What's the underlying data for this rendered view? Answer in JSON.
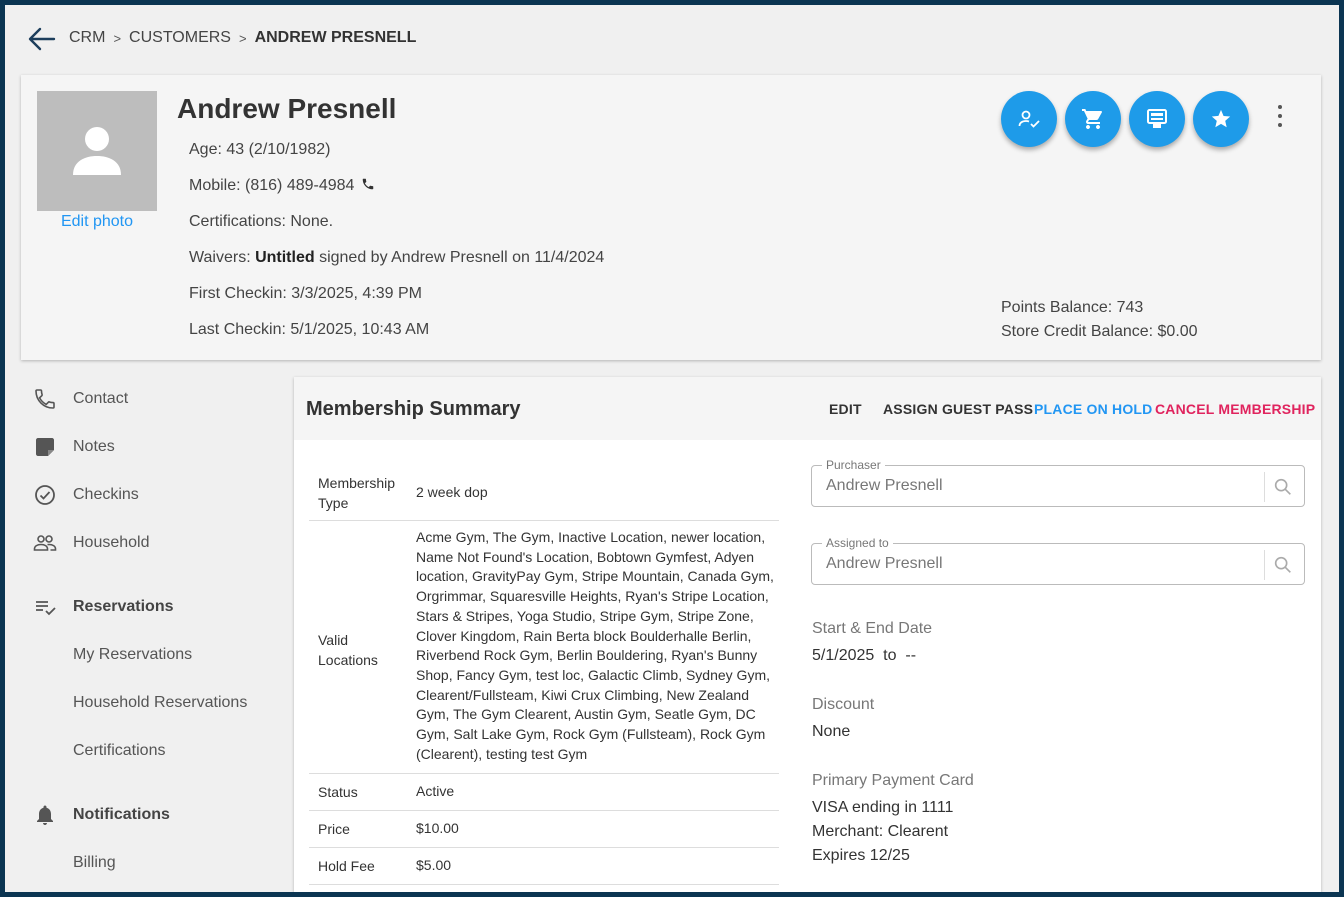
{
  "breadcrumb": {
    "items": [
      "CRM",
      "CUSTOMERS",
      "ANDREW PRESNELL"
    ],
    "separator": ">"
  },
  "profile": {
    "name": "Andrew Presnell",
    "edit_photo": "Edit photo",
    "age_label": "Age: 43 (2/10/1982)",
    "mobile_label": "Mobile: (816) 489-4984",
    "certifications_label": "Certifications: None.",
    "waivers_prefix": "Waivers: ",
    "waiver_name": "Untitled",
    "waiver_suffix": " signed by Andrew Presnell on 11/4/2024",
    "first_checkin": "First Checkin: 3/3/2025, 4:39 PM",
    "last_checkin": "Last Checkin: 5/1/2025, 10:43 AM",
    "points_balance": "Points Balance: 743",
    "store_credit": "Store Credit Balance: $0.00",
    "actions": [
      "person-check-icon",
      "cart-icon",
      "pos-terminal-icon",
      "star-icon"
    ],
    "accent_color": "#1e9be9"
  },
  "sidebar": {
    "items": [
      {
        "label": "Contact",
        "icon": "phone-icon"
      },
      {
        "label": "Notes",
        "icon": "notes-icon"
      },
      {
        "label": "Checkins",
        "icon": "check-circle-icon"
      },
      {
        "label": "Household",
        "icon": "people-icon"
      },
      {
        "label": "Reservations",
        "icon": "playlist-check-icon"
      },
      {
        "label": "My Reservations"
      },
      {
        "label": "Household Reservations"
      },
      {
        "label": "Certifications"
      },
      {
        "label": "Notifications",
        "icon": "bell-icon"
      },
      {
        "label": "Billing"
      }
    ]
  },
  "membership": {
    "title": "Membership Summary",
    "actions": {
      "edit": "EDIT",
      "guest_pass": "ASSIGN GUEST PASS",
      "hold": "PLACE ON HOLD",
      "cancel": "CANCEL MEMBERSHIP"
    },
    "rows": [
      {
        "key": "Membership Type",
        "value": "2 week dop"
      },
      {
        "key": "Valid Locations",
        "value": "Acme Gym, The Gym, Inactive Location, newer location, Name Not Found's Location, Bobtown Gymfest, Adyen location, GravityPay Gym, Stripe Mountain, Canada Gym, Orgrimmar, Squaresville Heights, Ryan's Stripe Location, Stars & Stripes, Yoga Studio, Stripe Gym, Stripe Zone, Clover Kingdom, Rain Berta block Boulderhalle Berlin, Riverbend Rock Gym, Berlin Bouldering, Ryan's Bunny Shop, Fancy Gym, test loc, Galactic Climb, Sydney Gym, Clearent/Fullsteam, Kiwi Crux Climbing, New Zealand Gym, The Gym Clearent, Austin Gym, Seatle Gym, DC Gym, Salt Lake Gym, Rock Gym (Fullsteam), Rock Gym (Clearent), testing test Gym"
      },
      {
        "key": "Status",
        "value": "Active"
      },
      {
        "key": "Price",
        "value": "$10.00"
      },
      {
        "key": "Hold Fee",
        "value": "$5.00"
      }
    ],
    "purchaser": {
      "label": "Purchaser",
      "value": "Andrew Presnell"
    },
    "assigned_to": {
      "label": "Assigned to",
      "value": "Andrew Presnell"
    },
    "dates": {
      "label": "Start & End Date",
      "value": "5/1/2025  to  --"
    },
    "discount": {
      "label": "Discount",
      "value": "None"
    },
    "payment": {
      "label": "Primary Payment Card",
      "card": "VISA ending in 1111",
      "merchant": "Merchant: Clearent",
      "expires": "Expires 12/25"
    }
  }
}
